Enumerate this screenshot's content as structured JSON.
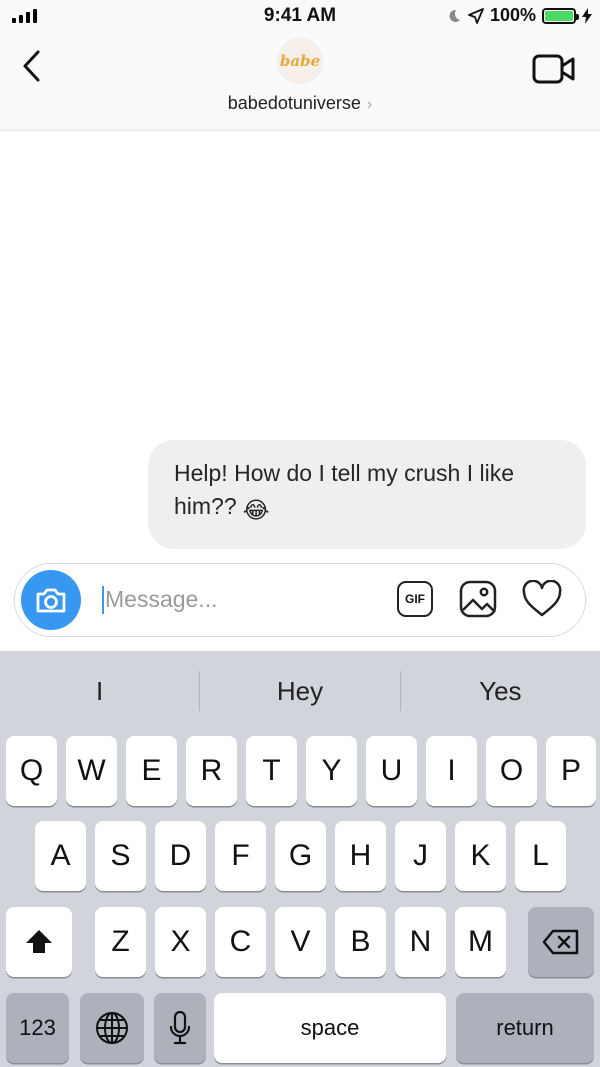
{
  "status": {
    "time": "9:41 AM",
    "battery_label": "100%"
  },
  "header": {
    "username": "babedotuniverse",
    "avatar_text": "babe",
    "chevron": "›"
  },
  "chat": {
    "message_text": "Help! How do I tell my crush I like him??",
    "message_emoji": "😂"
  },
  "composer": {
    "placeholder": "Message...",
    "gif_label": "GIF"
  },
  "keyboard": {
    "suggestions": [
      "I",
      "Hey",
      "Yes"
    ],
    "row1": [
      "Q",
      "W",
      "E",
      "R",
      "T",
      "Y",
      "U",
      "I",
      "O",
      "P"
    ],
    "row2": [
      "A",
      "S",
      "D",
      "F",
      "G",
      "H",
      "J",
      "K",
      "L"
    ],
    "row3": [
      "Z",
      "X",
      "C",
      "V",
      "B",
      "N",
      "M"
    ],
    "numbers_label": "123",
    "space_label": "space",
    "return_label": "return"
  },
  "colors": {
    "accent": "#3897f0",
    "battery": "#4cd964",
    "bubble": "#efefef",
    "keyboard_bg": "#d1d4db"
  }
}
